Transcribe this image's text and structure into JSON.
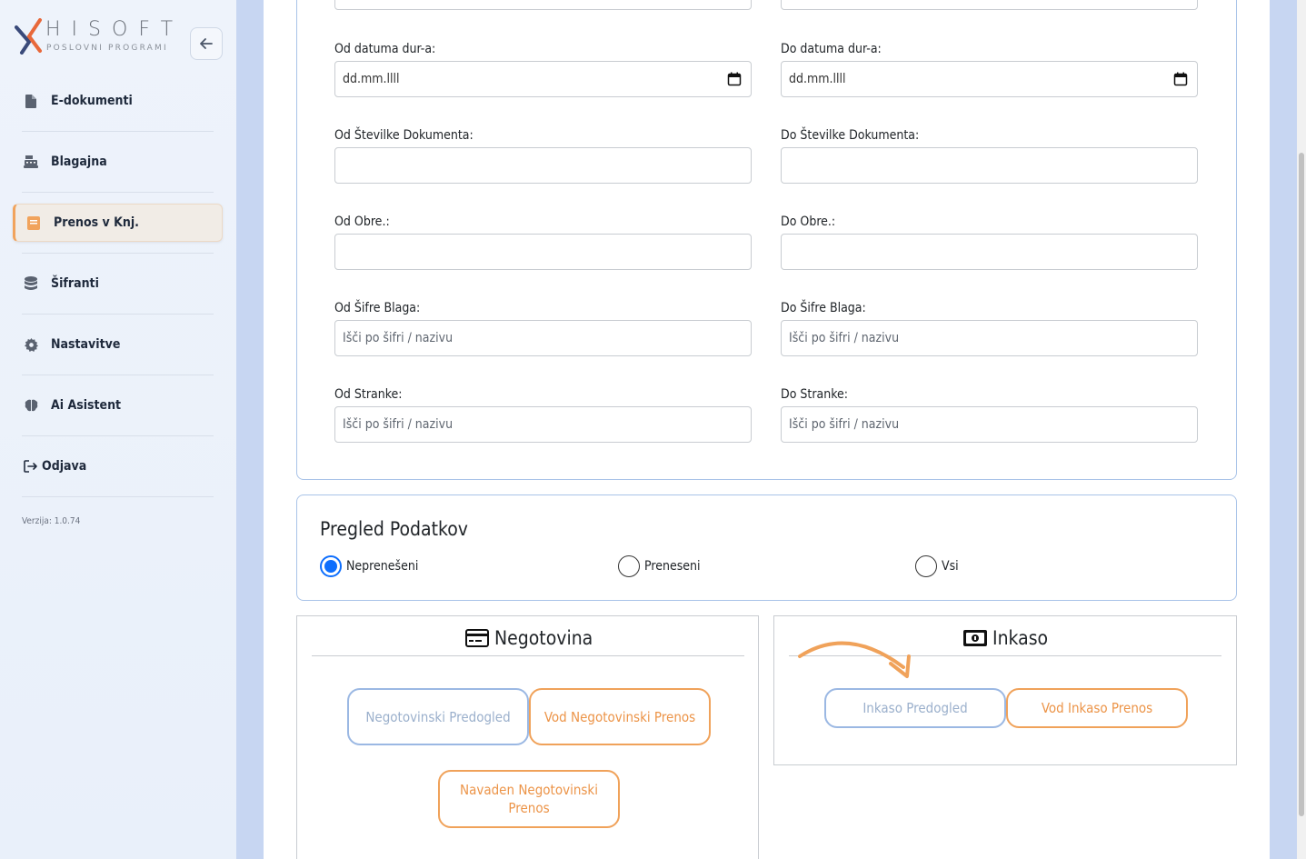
{
  "brand": {
    "name": "HISOFT",
    "tagline": "POSLOVNI PROGRAMI"
  },
  "sidebar": {
    "items": [
      {
        "label": "E-dokumenti",
        "icon": "file-icon",
        "active": false
      },
      {
        "label": "Blagajna",
        "icon": "cash-register-icon",
        "active": false
      },
      {
        "label": "Prenos v Knj.",
        "icon": "book-icon",
        "active": true
      },
      {
        "label": "Šifranti",
        "icon": "database-icon",
        "active": false
      },
      {
        "label": "Nastavitve",
        "icon": "gear-icon",
        "active": false
      },
      {
        "label": "Ai Asistent",
        "icon": "brain-icon",
        "active": false
      },
      {
        "label": "Odjava",
        "icon": "logout-icon",
        "active": false
      }
    ],
    "version": "Verzija: 1.0.74"
  },
  "filters": {
    "od_datuma_label": "Od datuma dur-a:",
    "od_datuma_value": "dd.mm.llll",
    "do_datuma_label": "Do datuma dur-a:",
    "do_datuma_value": "dd.mm.llll",
    "od_stevilke_label": "Od Številke Dokumenta:",
    "do_stevilke_label": "Do Številke Dokumenta:",
    "od_obre_label": "Od Obre.:",
    "do_obre_label": "Do Obre.:",
    "od_sifre_label": "Od Šifre Blaga:",
    "od_sifre_placeholder": "Išči po šifri / nazivu",
    "do_sifre_label": "Do Šifre Blaga:",
    "do_sifre_placeholder": "Išči po šifri / nazivu",
    "od_stranke_label": "Od Stranke:",
    "od_stranke_placeholder": "Išči po šifri / nazivu",
    "do_stranke_label": "Do Stranke:",
    "do_stranke_placeholder": "Išči po šifri / nazivu"
  },
  "pregled": {
    "title": "Pregled Podatkov",
    "options": [
      {
        "label": "Neprenešeni",
        "checked": true
      },
      {
        "label": "Preneseni",
        "checked": false
      },
      {
        "label": "Vsi",
        "checked": false
      }
    ]
  },
  "negotovina": {
    "title": "Negotovina",
    "btn_predogled": "Negotovinski Predogled",
    "btn_vod_prenos": "Vod Negotovinski Prenos",
    "btn_navaden_prenos": "Navaden Negotovinski Prenos"
  },
  "inkaso": {
    "title": "Inkaso",
    "btn_predogled": "Inkaso Predogled",
    "btn_vod_prenos": "Vod Inkaso Prenos"
  },
  "colors": {
    "accent_orange": "#f0a25a",
    "accent_blue": "#9bb8e3",
    "card_border": "#a9c3e8",
    "radio_checked": "#0d6efd"
  }
}
